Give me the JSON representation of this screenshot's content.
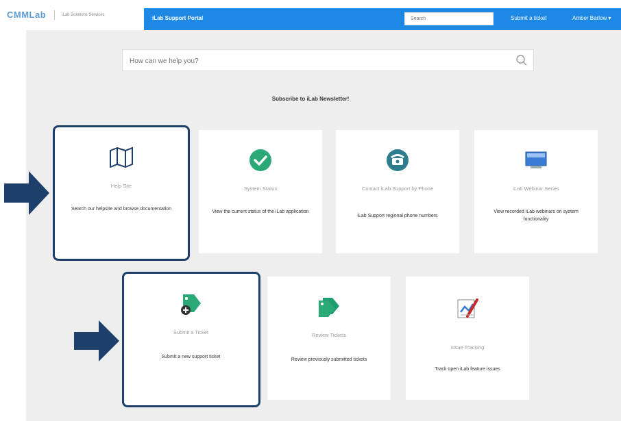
{
  "header": {
    "logo_text": "CMMLab",
    "logo_subtext": "iLab Solutions Services",
    "portal_title": "iLab Support Portal",
    "search_placeholder": "Search",
    "submit_ticket_label": "Submit a ticket",
    "user_label": "Amber Barlow ▾",
    "navbar_color": "#1e88e5"
  },
  "help_search": {
    "placeholder": "How can we help you?"
  },
  "newsletter": {
    "label": "Subscribe to iLab Newsletter!"
  },
  "cards_row1": [
    {
      "icon": "map-icon",
      "title": "Help Site",
      "description": "Search our helpsite and browse documentation",
      "highlighted": true
    },
    {
      "icon": "check-circle-icon",
      "title": "System Status",
      "description": "View the current status of the iLab application",
      "highlighted": false
    },
    {
      "icon": "phone-icon",
      "title": "Contact iLab Support by Phone",
      "description": "iLab Support regional phone numbers",
      "highlighted": false
    },
    {
      "icon": "video-icon",
      "title": "iLab Webinar Series",
      "description": "View recorded iLab webinars on system functionality",
      "highlighted": false
    }
  ],
  "cards_row2": [
    {
      "icon": "ticket-add-icon",
      "title": "Submit a Ticket",
      "description": "Submit a new support ticket",
      "highlighted": true
    },
    {
      "icon": "tickets-icon",
      "title": "Review Tickets",
      "description": "Review previously submitted tickets",
      "highlighted": false
    },
    {
      "icon": "issue-tracking-icon",
      "title": "Issue Tracking",
      "description": "Track open iLab feature issues",
      "highlighted": false
    }
  ],
  "colors": {
    "arrow": "#1f3f6b",
    "highlight_border": "#1f3f6b",
    "check_green": "#2aa876",
    "phone_teal": "#2e7d8c"
  }
}
